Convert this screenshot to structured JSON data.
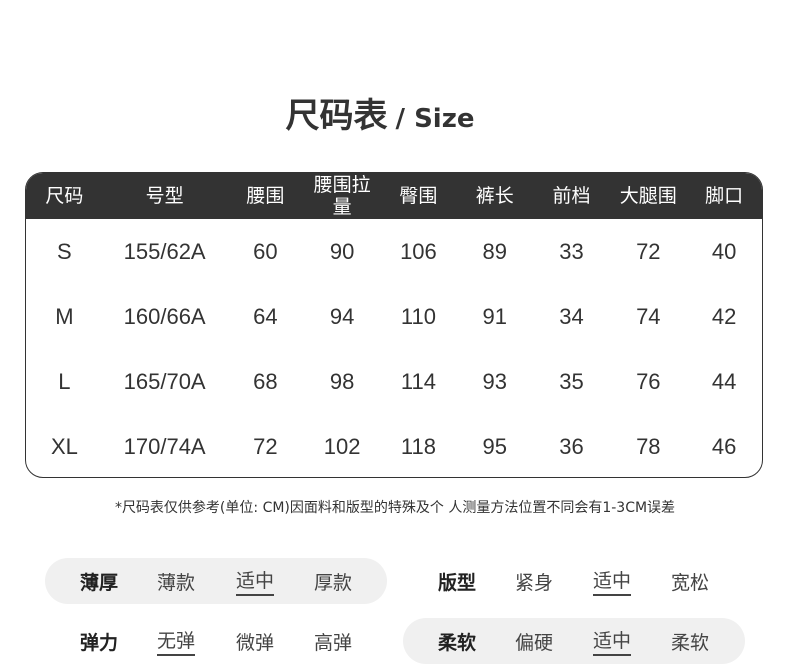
{
  "title": {
    "main": "尺码表",
    "sub": "/ Size"
  },
  "table": {
    "headers": [
      "尺码",
      "号型",
      "腰围",
      "腰围拉量",
      "臀围",
      "裤长",
      "前档",
      "大腿围",
      "脚口"
    ],
    "rows": [
      [
        "S",
        "155/62A",
        "60",
        "90",
        "106",
        "89",
        "33",
        "72",
        "40"
      ],
      [
        "M",
        "160/66A",
        "64",
        "94",
        "110",
        "91",
        "34",
        "74",
        "42"
      ],
      [
        "L",
        "165/70A",
        "68",
        "98",
        "114",
        "93",
        "35",
        "76",
        "44"
      ],
      [
        "XL",
        "170/74A",
        "72",
        "102",
        "118",
        "95",
        "36",
        "78",
        "46"
      ]
    ]
  },
  "note": "*尺码表仅供参考(单位: CM)因面料和版型的特殊及个 人测量方法位置不同会有1-3CM误差",
  "attributes": {
    "thickness": {
      "label": "薄厚",
      "options": [
        "薄款",
        "适中",
        "厚款"
      ],
      "selected": "适中"
    },
    "fit": {
      "label": "版型",
      "options": [
        "紧身",
        "适中",
        "宽松"
      ],
      "selected": "适中"
    },
    "elasticity": {
      "label": "弹力",
      "options": [
        "无弹",
        "微弹",
        "高弹"
      ],
      "selected": "无弹"
    },
    "softness": {
      "label": "柔软",
      "options": [
        "偏硬",
        "适中",
        "柔软"
      ],
      "selected": "适中"
    }
  }
}
